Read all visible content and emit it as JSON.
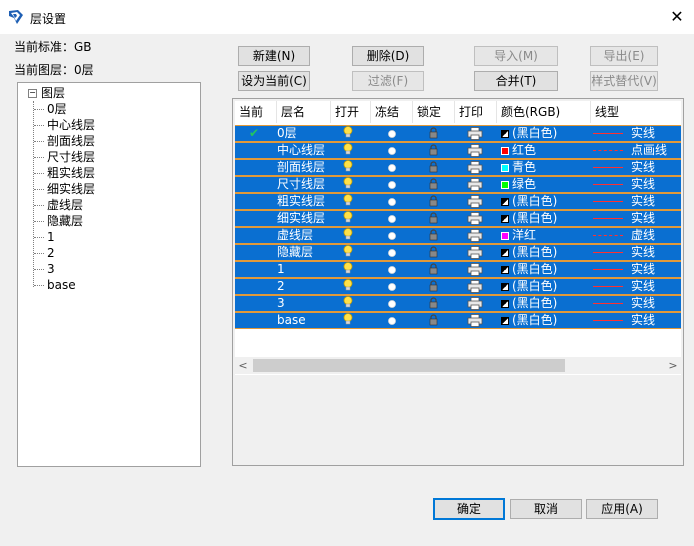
{
  "window": {
    "title": "层设置",
    "close_glyph": "✕"
  },
  "info": {
    "standard": "当前标准：GB",
    "current_layer": "当前图层：0层"
  },
  "tree": {
    "root_label": "图层",
    "expander": "−",
    "items": [
      "0层",
      "中心线层",
      "剖面线层",
      "尺寸线层",
      "粗实线层",
      "细实线层",
      "虚线层",
      "隐藏层",
      "1",
      "2",
      "3",
      "base"
    ]
  },
  "toolbar": {
    "new": "新建(N)",
    "delete": "删除(D)",
    "import": "导入(M)",
    "export": "导出(E)",
    "set_current": "设为当前(C)",
    "filter": "过滤(F)",
    "merge": "合并(T)",
    "style_override": "样式替代(V)"
  },
  "grid": {
    "columns": [
      "当前",
      "层名",
      "打开",
      "冻结",
      "锁定",
      "打印",
      "颜色(RGB)",
      "线型"
    ],
    "rows": [
      {
        "current": "✔",
        "name": "0层",
        "color": "(黑白色)",
        "swatch": "bw",
        "linetype": "实线",
        "dashed": false
      },
      {
        "current": "",
        "name": "中心线层",
        "color": "红色",
        "swatch": "#ff0000",
        "linetype": "点画线",
        "dashed": true
      },
      {
        "current": "",
        "name": "剖面线层",
        "color": "青色",
        "swatch": "#00ffff",
        "linetype": "实线",
        "dashed": false
      },
      {
        "current": "",
        "name": "尺寸线层",
        "color": "绿色",
        "swatch": "#00ff00",
        "linetype": "实线",
        "dashed": false
      },
      {
        "current": "",
        "name": "粗实线层",
        "color": "(黑白色)",
        "swatch": "bw",
        "linetype": "实线",
        "dashed": false
      },
      {
        "current": "",
        "name": "细实线层",
        "color": "(黑白色)",
        "swatch": "bw",
        "linetype": "实线",
        "dashed": false
      },
      {
        "current": "",
        "name": "虚线层",
        "color": "洋红",
        "swatch": "#ff00ff",
        "linetype": "虚线",
        "dashed": true
      },
      {
        "current": "",
        "name": "隐藏层",
        "color": "(黑白色)",
        "swatch": "bw",
        "linetype": "实线",
        "dashed": false
      },
      {
        "current": "",
        "name": "1",
        "color": "(黑白色)",
        "swatch": "bw",
        "linetype": "实线",
        "dashed": false
      },
      {
        "current": "",
        "name": "2",
        "color": "(黑白色)",
        "swatch": "bw",
        "linetype": "实线",
        "dashed": false
      },
      {
        "current": "",
        "name": "3",
        "color": "(黑白色)",
        "swatch": "bw",
        "linetype": "实线",
        "dashed": false
      },
      {
        "current": "",
        "name": "base",
        "color": "(黑白色)",
        "swatch": "bw",
        "linetype": "实线",
        "dashed": false
      }
    ],
    "scroll_left": "<",
    "scroll_right": ">"
  },
  "footer": {
    "ok": "确定",
    "cancel": "取消",
    "apply": "应用(A)"
  },
  "colors": {
    "selection": "#0a6fd1",
    "row_border": "#e0993a",
    "check": "#22c55e",
    "line_sample": "#ff3030"
  }
}
